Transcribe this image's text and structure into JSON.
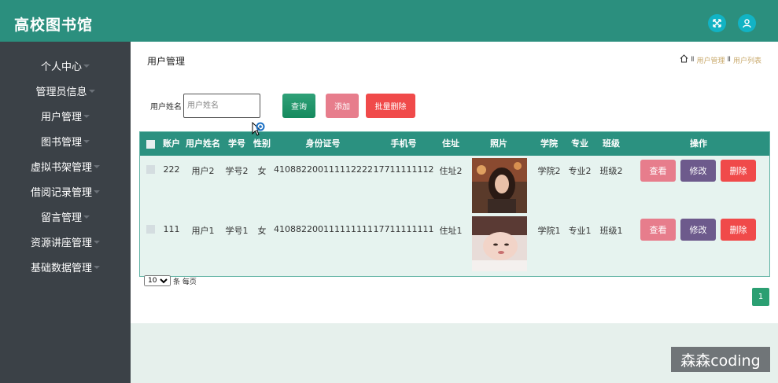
{
  "app": {
    "title": "高校图书馆"
  },
  "topbar_icons": [
    "fullscreen-icon",
    "user-icon"
  ],
  "sidebar": {
    "items": [
      {
        "label": "个人中心"
      },
      {
        "label": "管理员信息"
      },
      {
        "label": "用户管理"
      },
      {
        "label": "图书管理"
      },
      {
        "label": "虚拟书架管理"
      },
      {
        "label": "借阅记录管理"
      },
      {
        "label": "留言管理"
      },
      {
        "label": "资源讲座管理"
      },
      {
        "label": "基础数据管理"
      }
    ]
  },
  "page": {
    "title": "用户管理",
    "breadcrumb": [
      "用户管理",
      "用户列表"
    ]
  },
  "search": {
    "label": "用户姓名",
    "placeholder": "用户姓名",
    "value": "",
    "query_label": "查询",
    "add_label": "添加",
    "bulk_delete_label": "批量删除"
  },
  "table": {
    "headers": {
      "account": "账户",
      "name": "用户姓名",
      "student_id": "学号",
      "gender": "性别",
      "id_card": "身份证号",
      "phone": "手机号",
      "address": "住址",
      "photo": "照片",
      "college": "学院",
      "major": "专业",
      "class": "班级",
      "actions": "操作"
    },
    "rows": [
      {
        "account": "222",
        "name": "用户2",
        "student_id": "学号2",
        "gender": "女",
        "id_card": "410882200111112222",
        "phone": "17711111112",
        "address": "住址2",
        "college": "学院2",
        "major": "专业2",
        "class": "班级2"
      },
      {
        "account": "111",
        "name": "用户1",
        "student_id": "学号1",
        "gender": "女",
        "id_card": "410882200111111111",
        "phone": "17711111111",
        "address": "住址1",
        "college": "学院1",
        "major": "专业1",
        "class": "班级1"
      }
    ],
    "action_labels": {
      "view": "查看",
      "edit": "修改",
      "delete": "删除"
    }
  },
  "pagination": {
    "page_size": "10",
    "page_size_options": [
      "10"
    ],
    "per_page_suffix": "条 每页",
    "current_page": "1"
  },
  "watermark": "森森coding",
  "colors": {
    "topbar": "#2b8f7e",
    "sidebar": "#3b4147",
    "table_header": "#2b9180",
    "view_button": "#e77d8c",
    "edit_button": "#6d5a8c",
    "delete_button": "#f04a4a"
  }
}
